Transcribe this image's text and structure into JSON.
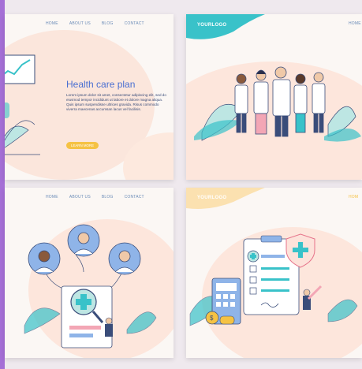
{
  "panel1": {
    "nav": [
      "HOME",
      "ABOUT US",
      "BLOG",
      "CONTACT"
    ],
    "title": "Health care plan",
    "body": "Lorem ipsum dolor sit amet, consectetur adipiscing elit, sed do eiusmod tempor incididunt ut labore et dolore magna aliqua. Quis ipsum suspendisse ultrices gravida. Risus commodo viverra maecenas accumsan lacus vel facilisis.",
    "button": "LEARN MORE"
  },
  "panel2": {
    "logo": "YOURLOGO",
    "nav_home": "HOME"
  },
  "panel3": {
    "nav": [
      "HOME",
      "ABOUT US",
      "BLOG",
      "CONTACT"
    ]
  },
  "panel4": {
    "logo": "YOURLOGO",
    "nav_home": "HOM"
  },
  "colors": {
    "accent_blue": "#4a6fd1",
    "teal": "#39c2c9",
    "mint": "#bde6e3",
    "peach": "#fbe3d9",
    "yellow": "#f5c244",
    "purple": "#a56fd6"
  }
}
